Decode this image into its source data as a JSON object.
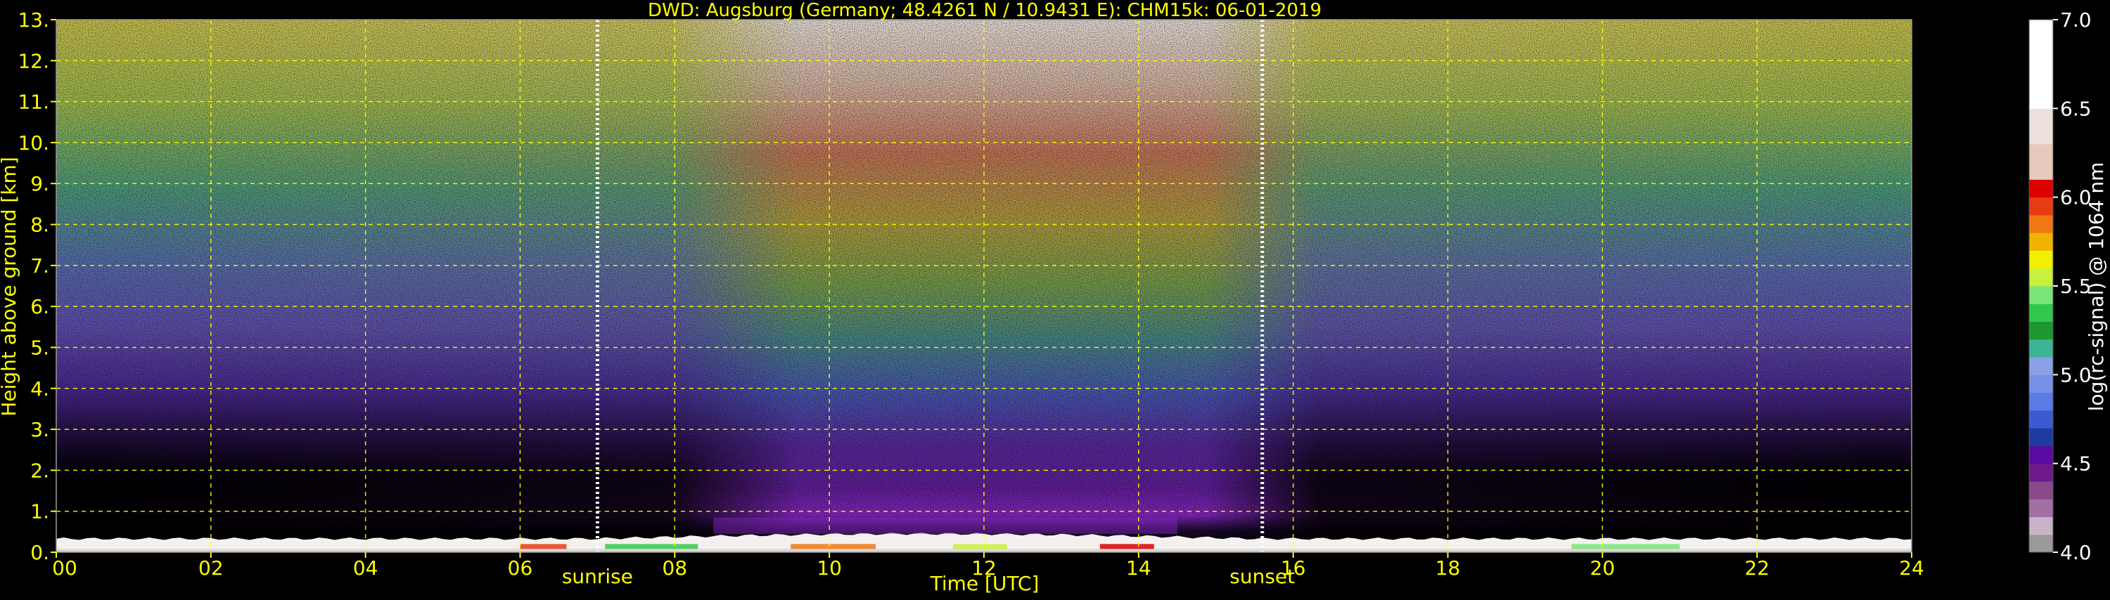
{
  "chart_data": {
    "type": "heatmap",
    "title": "DWD: Augsburg (Germany; 48.4261 N / 10.9431 E):    CHM15k: 06-01-2019",
    "xlabel": "Time [UTC]",
    "ylabel": "Height above ground [km]",
    "xlim": [
      0,
      24
    ],
    "ylim": [
      0,
      13
    ],
    "x_ticks": [
      0,
      2,
      4,
      6,
      8,
      10,
      12,
      14,
      16,
      18,
      20,
      22,
      24
    ],
    "x_tick_labels": [
      "00",
      "02",
      "04",
      "06",
      "08",
      "10",
      "12",
      "14",
      "16",
      "18",
      "20",
      "22",
      "24"
    ],
    "y_ticks": [
      0,
      1,
      2,
      3,
      4,
      5,
      6,
      7,
      8,
      9,
      10,
      11,
      12,
      13
    ],
    "y_tick_labels": [
      "0.",
      "1.",
      "2.",
      "3.",
      "4.",
      "5.",
      "6.",
      "7.",
      "8.",
      "9.",
      "10.",
      "11.",
      "12.",
      "13."
    ],
    "grid": true,
    "annotations": [
      {
        "text": "sunrise",
        "x": 7.0
      },
      {
        "text": "sunset",
        "x": 15.6
      }
    ],
    "colorbar": {
      "label": "log(rc-signal) @ 1064 nm",
      "range": [
        4.0,
        7.0
      ],
      "ticks": [
        4.0,
        4.5,
        5.0,
        5.5,
        6.0,
        6.5,
        7.0
      ],
      "tick_labels": [
        "4.0",
        "4.5",
        "5.0",
        "5.5",
        "6.0",
        "6.5",
        "7.0"
      ],
      "levels": [
        {
          "from": 4.0,
          "to": 4.1,
          "color": "#9a9a9a"
        },
        {
          "from": 4.1,
          "to": 4.2,
          "color": "#c8b4c8"
        },
        {
          "from": 4.2,
          "to": 4.3,
          "color": "#a070a0"
        },
        {
          "from": 4.3,
          "to": 4.4,
          "color": "#8a4a8a"
        },
        {
          "from": 4.4,
          "to": 4.5,
          "color": "#6e1a8c"
        },
        {
          "from": 4.5,
          "to": 4.6,
          "color": "#5a0aa0"
        },
        {
          "from": 4.6,
          "to": 4.7,
          "color": "#1e3ca0"
        },
        {
          "from": 4.7,
          "to": 4.8,
          "color": "#3c5ad2"
        },
        {
          "from": 4.8,
          "to": 4.9,
          "color": "#5a7ae6"
        },
        {
          "from": 4.9,
          "to": 5.0,
          "color": "#7890e6"
        },
        {
          "from": 5.0,
          "to": 5.1,
          "color": "#8ca0e6"
        },
        {
          "from": 5.1,
          "to": 5.2,
          "color": "#3cb496"
        },
        {
          "from": 5.2,
          "to": 5.3,
          "color": "#1e9632"
        },
        {
          "from": 5.3,
          "to": 5.4,
          "color": "#32c850"
        },
        {
          "from": 5.4,
          "to": 5.5,
          "color": "#78e678"
        },
        {
          "from": 5.5,
          "to": 5.6,
          "color": "#c8f03c"
        },
        {
          "from": 5.6,
          "to": 5.7,
          "color": "#f0f000"
        },
        {
          "from": 5.7,
          "to": 5.8,
          "color": "#f0b400"
        },
        {
          "from": 5.8,
          "to": 5.9,
          "color": "#f07814"
        },
        {
          "from": 5.9,
          "to": 6.0,
          "color": "#e63c14"
        },
        {
          "from": 6.0,
          "to": 6.1,
          "color": "#dc0000"
        },
        {
          "from": 6.1,
          "to": 6.3,
          "color": "#e6c8bc"
        },
        {
          "from": 6.3,
          "to": 6.5,
          "color": "#ece0dc"
        },
        {
          "from": 6.5,
          "to": 7.0,
          "color": "#ffffff"
        }
      ]
    },
    "sunrise_time": 7.0,
    "sunset_time": 15.6,
    "colors": {
      "text": "#ffff00",
      "grid": "#ffff00",
      "background": "#000000",
      "colorbar_text": "#ffffff",
      "marker_line": "#ffffff"
    }
  }
}
